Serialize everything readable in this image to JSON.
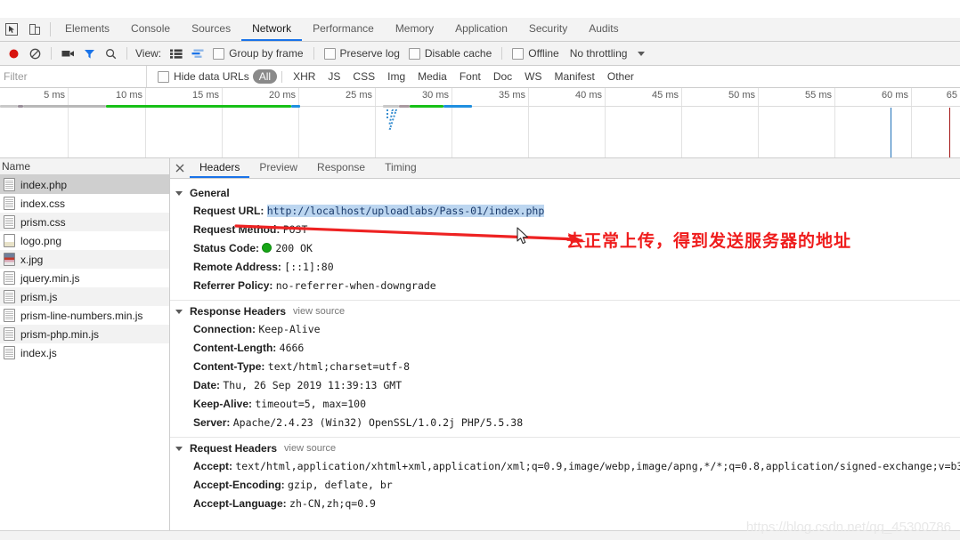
{
  "tabbar": {
    "inspect_icon": "inspect-cursor-icon",
    "device_icon": "device-toolbar-icon",
    "tabs": [
      {
        "label": "Elements",
        "active": false
      },
      {
        "label": "Console",
        "active": false
      },
      {
        "label": "Sources",
        "active": false
      },
      {
        "label": "Network",
        "active": true
      },
      {
        "label": "Performance",
        "active": false
      },
      {
        "label": "Memory",
        "active": false
      },
      {
        "label": "Application",
        "active": false
      },
      {
        "label": "Security",
        "active": false
      },
      {
        "label": "Audits",
        "active": false
      }
    ]
  },
  "toolbar": {
    "record_icon": "record-circle-icon",
    "clear_icon": "clear-no-entry-icon",
    "capture_icon": "camera-filmstrip-icon",
    "filter_icon": "filter-funnel-icon",
    "search_icon": "search-magnifier-icon",
    "view_label": "View:",
    "list_view_icon": "list-view-icon",
    "waterfall_view_icon": "waterfall-view-icon",
    "group_by_frame": "Group by frame",
    "preserve_log": "Preserve log",
    "disable_cache": "Disable cache",
    "offline": "Offline",
    "throttling": "No throttling",
    "throttle_caret_icon": "chevron-down-icon"
  },
  "filterbar": {
    "placeholder": "Filter",
    "hide_data_urls": "Hide data URLs",
    "types": [
      "All",
      "XHR",
      "JS",
      "CSS",
      "Img",
      "Media",
      "Font",
      "Doc",
      "WS",
      "Manifest",
      "Other"
    ],
    "active_type": "All"
  },
  "overview": {
    "ticks": [
      "5 ms",
      "10 ms",
      "15 ms",
      "20 ms",
      "25 ms",
      "30 ms",
      "35 ms",
      "40 ms",
      "45 ms",
      "50 ms",
      "55 ms",
      "60 ms",
      "65"
    ],
    "dom_content_loaded_color": "#1d6fb8",
    "load_event_color": "#a31515",
    "bar_wait_color": "#b8b8b8",
    "bar_download_color": "#17c017",
    "bar_receive_color": "#1f8fe0"
  },
  "namecol": {
    "header": "Name",
    "files": [
      {
        "name": "index.php",
        "icon": "document-icon",
        "selected": true
      },
      {
        "name": "index.css",
        "icon": "document-icon",
        "selected": false
      },
      {
        "name": "prism.css",
        "icon": "document-icon",
        "selected": false
      },
      {
        "name": "logo.png",
        "icon": "image-icon",
        "selected": false
      },
      {
        "name": "x.jpg",
        "icon": "image-icon",
        "selected": false
      },
      {
        "name": "jquery.min.js",
        "icon": "document-icon",
        "selected": false
      },
      {
        "name": "prism.js",
        "icon": "document-icon",
        "selected": false
      },
      {
        "name": "prism-line-numbers.min.js",
        "icon": "document-icon",
        "selected": false
      },
      {
        "name": "prism-php.min.js",
        "icon": "document-icon",
        "selected": false
      },
      {
        "name": "index.js",
        "icon": "document-icon",
        "selected": false
      }
    ]
  },
  "detail": {
    "close_icon": "close-x-icon",
    "tabs": [
      {
        "label": "Headers",
        "active": true
      },
      {
        "label": "Preview",
        "active": false
      },
      {
        "label": "Response",
        "active": false
      },
      {
        "label": "Timing",
        "active": false
      }
    ],
    "general": {
      "title": "General",
      "request_url_key": "Request URL:",
      "request_url_value": "http://localhost/uploadlabs/Pass-01/index.php",
      "request_method_key": "Request Method:",
      "request_method_value": "POST",
      "status_code_key": "Status Code:",
      "status_code_value": "200 OK",
      "remote_address_key": "Remote Address:",
      "remote_address_value": "[::1]:80",
      "referrer_policy_key": "Referrer Policy:",
      "referrer_policy_value": "no-referrer-when-downgrade"
    },
    "response_headers": {
      "title": "Response Headers",
      "view_source": "view source",
      "rows": [
        {
          "key": "Connection:",
          "value": "Keep-Alive"
        },
        {
          "key": "Content-Length:",
          "value": "4666"
        },
        {
          "key": "Content-Type:",
          "value": "text/html;charset=utf-8"
        },
        {
          "key": "Date:",
          "value": "Thu, 26 Sep 2019 11:39:13 GMT"
        },
        {
          "key": "Keep-Alive:",
          "value": "timeout=5, max=100"
        },
        {
          "key": "Server:",
          "value": "Apache/2.4.23 (Win32) OpenSSL/1.0.2j PHP/5.5.38"
        }
      ]
    },
    "request_headers": {
      "title": "Request Headers",
      "view_source": "view source",
      "rows": [
        {
          "key": "Accept:",
          "value": "text/html,application/xhtml+xml,application/xml;q=0.9,image/webp,image/apng,*/*;q=0.8,application/signed-exchange;v=b3"
        },
        {
          "key": "Accept-Encoding:",
          "value": "gzip, deflate, br"
        },
        {
          "key": "Accept-Language:",
          "value": "zh-CN,zh;q=0.9"
        }
      ]
    }
  },
  "annotation": {
    "text": "去正常上传，得到发送服务器的地址",
    "color": "#ef1c1c",
    "arrow_icon": "red-arrow-icon",
    "cursor_icon": "mouse-pointer-icon"
  },
  "watermark": {
    "text": "https://blog.csdn.net/qq_45300786"
  }
}
